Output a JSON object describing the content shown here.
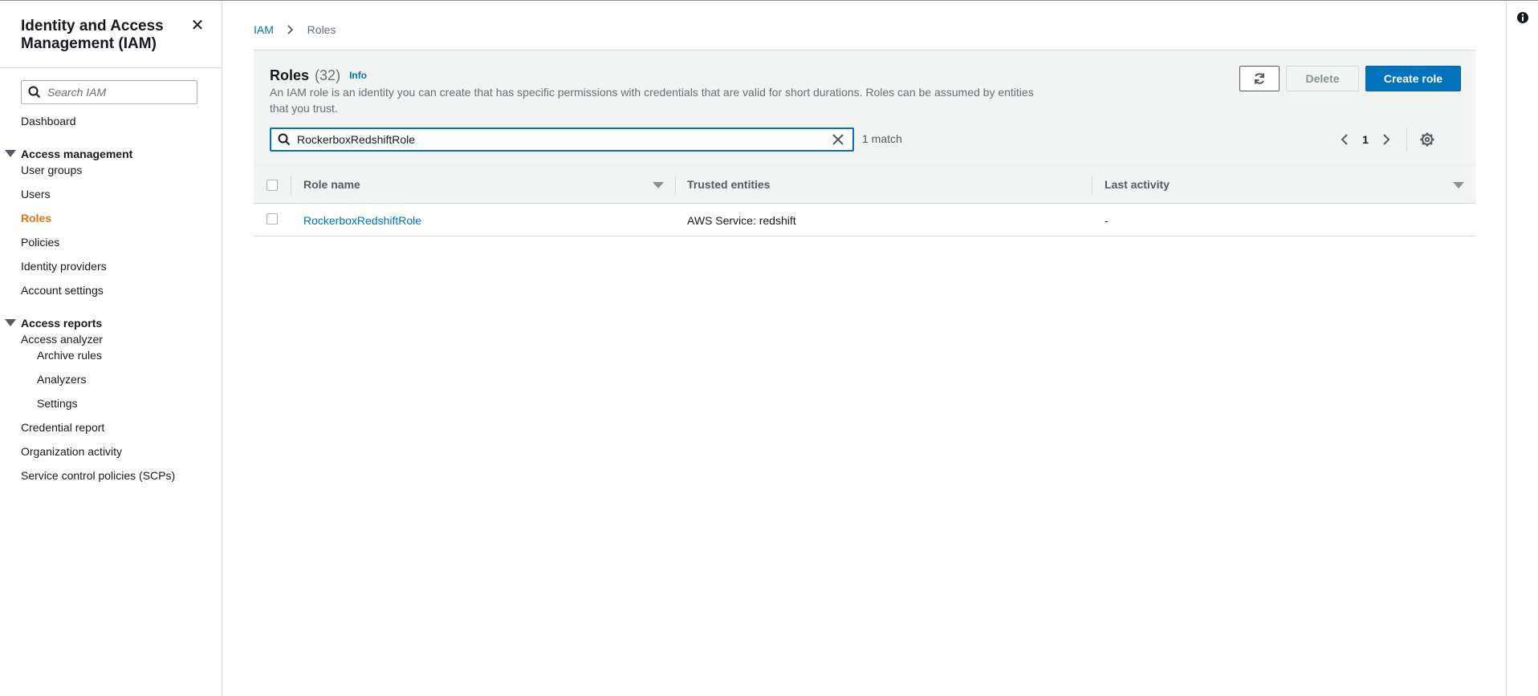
{
  "sidebar": {
    "title": "Identity and Access Management (IAM)",
    "close_icon": "close-icon",
    "search": {
      "placeholder": "Search IAM",
      "value": ""
    },
    "items": {
      "dashboard": "Dashboard",
      "access_management": "Access management",
      "user_groups": "User groups",
      "users": "Users",
      "roles": "Roles",
      "policies": "Policies",
      "identity_providers": "Identity providers",
      "account_settings": "Account settings",
      "access_reports": "Access reports",
      "access_analyzer": "Access analyzer",
      "archive_rules": "Archive rules",
      "analyzers": "Analyzers",
      "settings": "Settings",
      "credential_report": "Credential report",
      "organization_activity": "Organization activity",
      "scps": "Service control policies (SCPs)"
    },
    "active_item": "Roles",
    "active_color": "#ec7211"
  },
  "breadcrumb": {
    "root": "IAM",
    "current": "Roles"
  },
  "roles_panel": {
    "title": "Roles",
    "count": "(32)",
    "info": "Info",
    "description": "An IAM role is an identity you can create that has specific permissions with credentials that are valid for short durations. Roles can be assumed by entities that you trust.",
    "buttons": {
      "refresh_icon": "refresh-icon",
      "delete": "Delete",
      "create": "Create role"
    },
    "filter": {
      "value": "RockerboxRedshiftRole",
      "match_text": "1 match"
    },
    "pagination": {
      "current_page": "1"
    }
  },
  "table": {
    "columns": {
      "role_name": "Role name",
      "trusted_entities": "Trusted entities",
      "last_activity": "Last activity"
    },
    "rows": [
      {
        "role_name": "RockerboxRedshiftRole",
        "trusted_entities": "AWS Service: redshift",
        "last_activity": "-"
      }
    ]
  },
  "colors": {
    "link": "#0073bb",
    "primary_button": "#0073bb",
    "header_bg": "#f2f3f3"
  }
}
